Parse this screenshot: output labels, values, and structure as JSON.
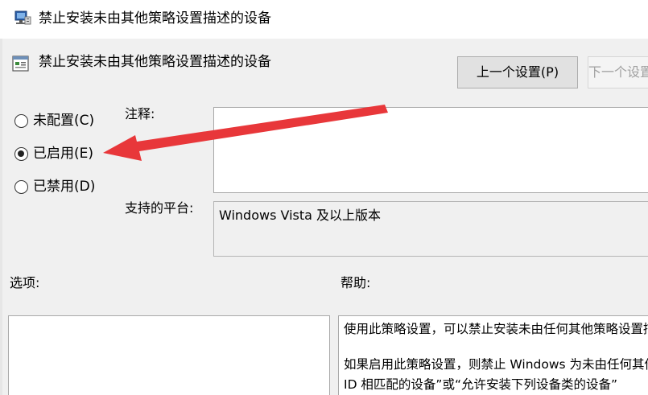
{
  "window": {
    "title": "禁止安装未由其他策略设置描述的设备"
  },
  "header": {
    "policy_name": "禁止安装未由其他策略设置描述的设备",
    "prev_button": "上一个设置(P)",
    "next_button": "下一个设置(N)"
  },
  "state_options": [
    {
      "label": "未配置(C)",
      "checked": false
    },
    {
      "label": "已启用(E)",
      "checked": true
    },
    {
      "label": "已禁用(D)",
      "checked": false
    }
  ],
  "comment": {
    "label": "注释:",
    "value": ""
  },
  "platform": {
    "label": "支持的平台:",
    "value": "Windows Vista 及以上版本"
  },
  "options": {
    "label": "选项:"
  },
  "help": {
    "label": "帮助:",
    "lines": [
      "使用此策略设置，可以禁止安装未由任何其他策略设置描述的设备。",
      "",
      "如果启用此策略设置，则禁止 Windows 为未由任何其他策略设置描述的设备安装或更新设备驱动程序",
      "ID 相匹配的设备”或“允许安装下列设备类的设备”"
    ]
  },
  "annotation": {
    "arrow_color": "#e8373a"
  }
}
